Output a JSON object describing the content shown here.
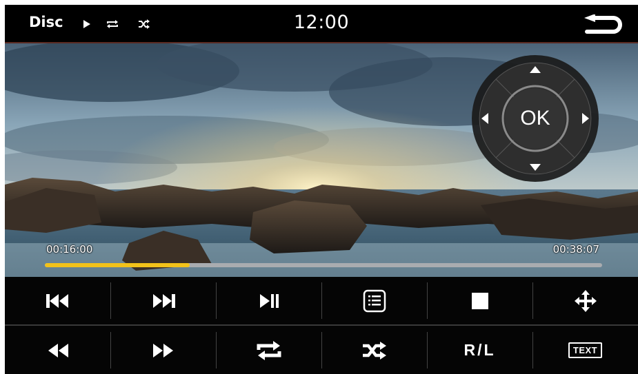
{
  "status": {
    "source": "Disc",
    "clock": "12:00"
  },
  "player": {
    "current_time": "00:16:00",
    "total_time": "00:38:07",
    "progress_fraction": 0.26,
    "progress_color": "#f2c21a"
  },
  "dpad": {
    "ok_label": "OK"
  },
  "controls": {
    "row1": [
      "previous-track",
      "next-track",
      "play-pause",
      "playlist",
      "stop",
      "move"
    ],
    "row2": [
      "rewind",
      "fast-forward",
      "repeat",
      "shuffle",
      "r-l",
      "text"
    ],
    "rl_label": "R/L",
    "text_label": "TEXT"
  }
}
